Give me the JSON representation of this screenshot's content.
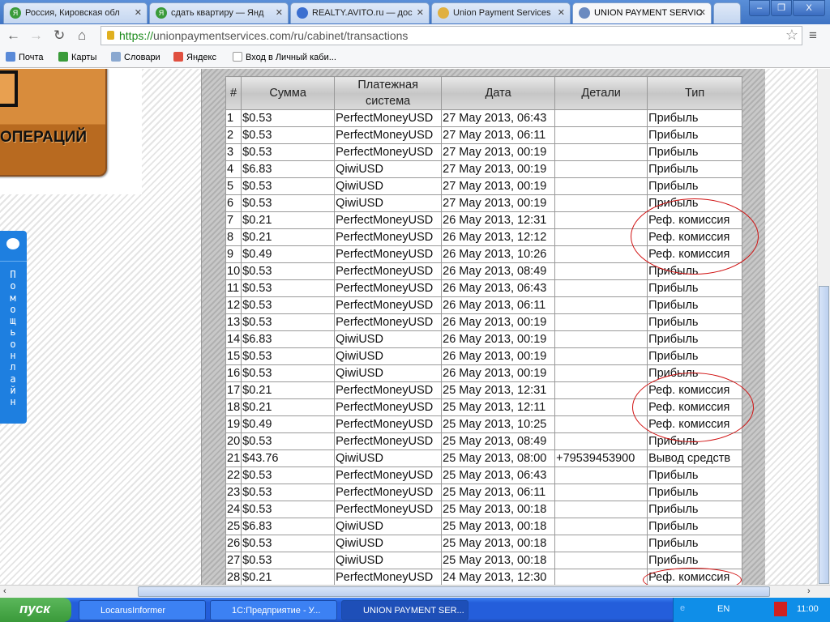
{
  "browser": {
    "tabs": [
      {
        "label": "Россия, Кировская обл"
      },
      {
        "label": "сдать квартиру — Янд"
      },
      {
        "label": "REALTY.AVITO.ru — дос"
      },
      {
        "label": "Union Payment Services"
      },
      {
        "label": "UNION PAYMENT SERVIC"
      }
    ],
    "url_scheme": "https://",
    "url_rest": "unionpaymentservices.com/ru/cabinet/transactions",
    "bookmarks": [
      "Почта",
      "Карты",
      "Словари",
      "Яндекс",
      "Вход в Личный каби..."
    ]
  },
  "page": {
    "logo_text": "ОПЕРАЦИЙ",
    "help_text": "Помощь онлайн",
    "table": {
      "headers": [
        "#",
        "Сумма",
        "Платежная система",
        "Дата",
        "Детали",
        "Тип"
      ],
      "rows": [
        [
          "1",
          "$0.53",
          "PerfectMoneyUSD",
          "27 May 2013, 06:43",
          "",
          "Прибыль"
        ],
        [
          "2",
          "$0.53",
          "PerfectMoneyUSD",
          "27 May 2013, 06:11",
          "",
          "Прибыль"
        ],
        [
          "3",
          "$0.53",
          "PerfectMoneyUSD",
          "27 May 2013, 00:19",
          "",
          "Прибыль"
        ],
        [
          "4",
          "$6.83",
          "QiwiUSD",
          "27 May 2013, 00:19",
          "",
          "Прибыль"
        ],
        [
          "5",
          "$0.53",
          "QiwiUSD",
          "27 May 2013, 00:19",
          "",
          "Прибыль"
        ],
        [
          "6",
          "$0.53",
          "QiwiUSD",
          "27 May 2013, 00:19",
          "",
          "Прибыль"
        ],
        [
          "7",
          "$0.21",
          "PerfectMoneyUSD",
          "26 May 2013, 12:31",
          "",
          "Реф. комиссия"
        ],
        [
          "8",
          "$0.21",
          "PerfectMoneyUSD",
          "26 May 2013, 12:12",
          "",
          "Реф. комиссия"
        ],
        [
          "9",
          "$0.49",
          "PerfectMoneyUSD",
          "26 May 2013, 10:26",
          "",
          "Реф. комиссия"
        ],
        [
          "10",
          "$0.53",
          "PerfectMoneyUSD",
          "26 May 2013, 08:49",
          "",
          "Прибыль"
        ],
        [
          "11",
          "$0.53",
          "PerfectMoneyUSD",
          "26 May 2013, 06:43",
          "",
          "Прибыль"
        ],
        [
          "12",
          "$0.53",
          "PerfectMoneyUSD",
          "26 May 2013, 06:11",
          "",
          "Прибыль"
        ],
        [
          "13",
          "$0.53",
          "PerfectMoneyUSD",
          "26 May 2013, 00:19",
          "",
          "Прибыль"
        ],
        [
          "14",
          "$6.83",
          "QiwiUSD",
          "26 May 2013, 00:19",
          "",
          "Прибыль"
        ],
        [
          "15",
          "$0.53",
          "QiwiUSD",
          "26 May 2013, 00:19",
          "",
          "Прибыль"
        ],
        [
          "16",
          "$0.53",
          "QiwiUSD",
          "26 May 2013, 00:19",
          "",
          "Прибыль"
        ],
        [
          "17",
          "$0.21",
          "PerfectMoneyUSD",
          "25 May 2013, 12:31",
          "",
          "Реф. комиссия"
        ],
        [
          "18",
          "$0.21",
          "PerfectMoneyUSD",
          "25 May 2013, 12:11",
          "",
          "Реф. комиссия"
        ],
        [
          "19",
          "$0.49",
          "PerfectMoneyUSD",
          "25 May 2013, 10:25",
          "",
          "Реф. комиссия"
        ],
        [
          "20",
          "$0.53",
          "PerfectMoneyUSD",
          "25 May 2013, 08:49",
          "",
          "Прибыль"
        ],
        [
          "21",
          "$43.76",
          "QiwiUSD",
          "25 May 2013, 08:00",
          "+79539453900",
          "Вывод средств"
        ],
        [
          "22",
          "$0.53",
          "PerfectMoneyUSD",
          "25 May 2013, 06:43",
          "",
          "Прибыль"
        ],
        [
          "23",
          "$0.53",
          "PerfectMoneyUSD",
          "25 May 2013, 06:11",
          "",
          "Прибыль"
        ],
        [
          "24",
          "$0.53",
          "PerfectMoneyUSD",
          "25 May 2013, 00:18",
          "",
          "Прибыль"
        ],
        [
          "25",
          "$6.83",
          "QiwiUSD",
          "25 May 2013, 00:18",
          "",
          "Прибыль"
        ],
        [
          "26",
          "$0.53",
          "QiwiUSD",
          "25 May 2013, 00:18",
          "",
          "Прибыль"
        ],
        [
          "27",
          "$0.53",
          "QiwiUSD",
          "25 May 2013, 00:18",
          "",
          "Прибыль"
        ],
        [
          "28",
          "$0.21",
          "PerfectMoneyUSD",
          "24 May 2013, 12:30",
          "",
          "Реф. комиссия"
        ]
      ]
    }
  },
  "taskbar": {
    "start": "пуск",
    "items": [
      "LocarusInformer",
      "1С:Предприятие - У...",
      "UNION PAYMENT SER..."
    ],
    "lang": "EN",
    "clock": "11:00"
  }
}
